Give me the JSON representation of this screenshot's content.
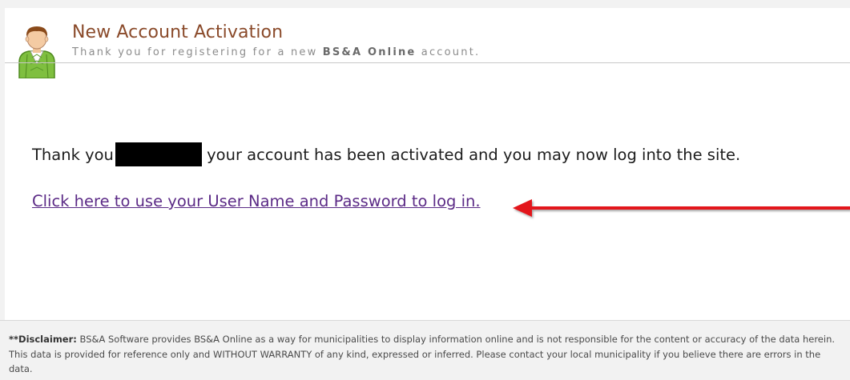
{
  "header": {
    "title": "New Account Activation",
    "subtitle_before": "Thank you for registering for a new",
    "subtitle_brand": "BS&A Online",
    "subtitle_after": "account."
  },
  "message": {
    "before": "Thank you",
    "after": "your account has been activated and you may now log into the site."
  },
  "login_link": "Click here to use your User Name and Password to log in.",
  "disclaimer": {
    "label": "**Disclaimer:",
    "text": "BS&A Software provides BS&A Online as a way for municipalities to display information online and is not responsible for the content or accuracy of the data herein. This data is provided for reference only and WITHOUT WARRANTY of any kind, expressed or inferred. Please contact your local municipality if you believe there are errors in the data."
  },
  "colors": {
    "title": "#8a4a2a",
    "link": "#5b2a86",
    "arrow": "#e3151a"
  },
  "icons": {
    "avatar": "user-avatar-icon",
    "arrow": "red-arrow-annotation"
  }
}
